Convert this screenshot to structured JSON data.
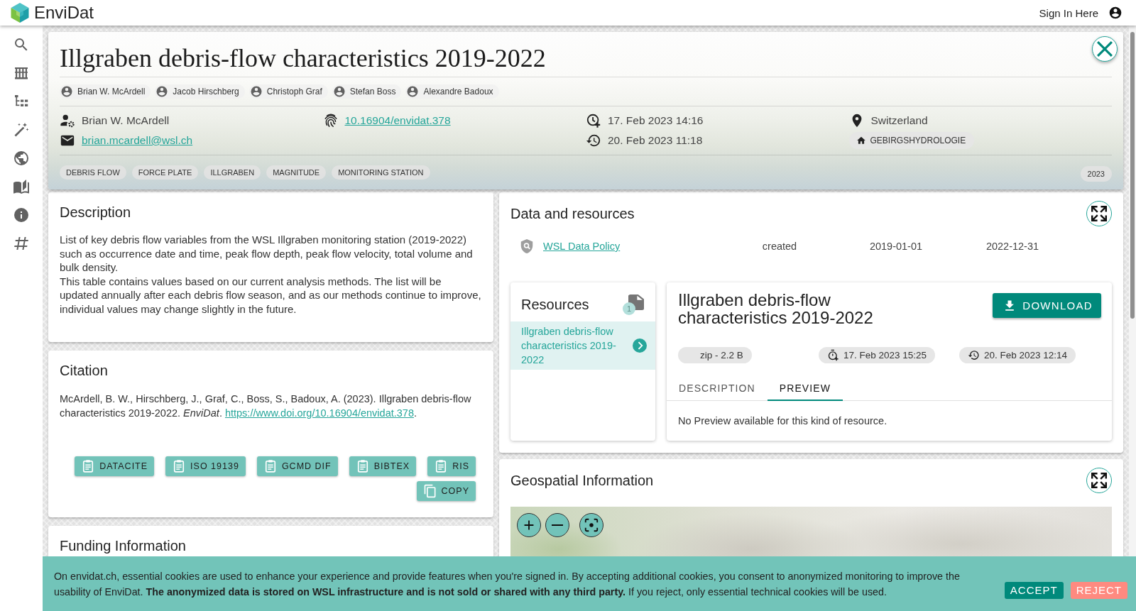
{
  "app_bar": {
    "brand": "EnviDat",
    "sign_in": "Sign In Here"
  },
  "sidebar": {
    "items": [
      {
        "kind": "search"
      },
      {
        "kind": "shelf"
      },
      {
        "kind": "tree"
      },
      {
        "kind": "tools"
      },
      {
        "kind": "globe"
      },
      {
        "kind": "guide"
      },
      {
        "kind": "info"
      },
      {
        "kind": "hash"
      }
    ]
  },
  "dataset_header": {
    "title": "Illgraben debris-flow characteristics 2019-2022",
    "authors": [
      "Brian W. McArdell",
      "Jacob Hirschberg",
      "Christoph Graf",
      "Stefan Boss",
      "Alexandre Badoux"
    ],
    "info_columns": [
      [
        {
          "kind": "contact",
          "text": "Brian W. McArdell"
        },
        {
          "kind": "email",
          "text": "brian.mcardell@wsl.ch"
        }
      ],
      [
        {
          "kind": "doi",
          "text": "10.16904/envidat.378"
        }
      ],
      [
        {
          "kind": "created",
          "text": "17. Feb 2023 14:16"
        },
        {
          "kind": "modified",
          "text": "20. Feb 2023 11:18"
        }
      ],
      [
        {
          "kind": "location",
          "text": "Switzerland"
        },
        {
          "kind": "organization",
          "text": "GEBIRGSHYDROLOGIE"
        }
      ]
    ],
    "tags": [
      "DEBRIS FLOW",
      "FORCE PLATE",
      "ILLGRABEN",
      "MAGNITUDE",
      "MONITORING STATION"
    ],
    "year": "2023"
  },
  "description": {
    "title": "Description",
    "paragraphs": [
      "List of key debris flow variables from the WSL Illgraben monitoring station (2019-2022) such as occurrence date and time, peak flow depth, peak flow velocity, total volume and bulk density.",
      "This table contains values based on our current analysis methods. The list will be updated annually after each debris flow season, and as our methods continue to improve, individual values may change slightly in the future."
    ]
  },
  "citation": {
    "title": "Citation",
    "text": "McArdell, B. W., Hirschberg, J., Graf, C., Boss, S., Badoux, A. (2023). Illgraben debris-flow characteristics 2019-2022. *EnviDat*.",
    "link": "https://www.doi.org/10.16904/envidat.378",
    "end": ".",
    "buttons": [
      {
        "kind": "export",
        "label": "DATACITE"
      },
      {
        "kind": "export",
        "label": "ISO 19139"
      },
      {
        "kind": "export",
        "label": "GCMD DIF"
      },
      {
        "kind": "export",
        "label": "BIBTEX"
      },
      {
        "kind": "export",
        "label": "RIS"
      },
      {
        "kind": "copy",
        "label": "COPY"
      }
    ]
  },
  "funding": {
    "title": "Funding Information"
  },
  "data_resources": {
    "title": "Data and resources",
    "license": "WSL Data Policy",
    "dates": [
      "created",
      "2019-01-01",
      "2022-12-31"
    ],
    "resources": {
      "title": "Resources",
      "count": "1",
      "items": [
        {
          "name": "Illgraben debris-flow characteristics 2019-2022",
          "selected": true
        }
      ]
    },
    "detail": {
      "title": "Illgraben debris-flow characteristics 2019-2022",
      "download": "DOWNLOAD",
      "chips": [
        {
          "kind": "format",
          "text": "zip - 2.2 B"
        },
        {
          "kind": "created",
          "text": "17. Feb 2023 15:25"
        },
        {
          "kind": "modified",
          "text": "20. Feb 2023 12:14"
        }
      ],
      "tabs": [
        {
          "label": "DESCRIPTION",
          "selected": false
        },
        {
          "label": "PREVIEW",
          "selected": true
        }
      ],
      "preview": "No Preview available for this kind of resource."
    }
  },
  "geospatial": {
    "title": "Geospatial Information",
    "map_controls": [
      {
        "kind": "zoom_in"
      },
      {
        "kind": "zoom_out"
      },
      {
        "kind": "fit"
      }
    ]
  },
  "cookie_banner": {
    "text": "On envidat.ch, essential cookies are used to enhance your experience and provide features when you're signed in. By accepting additional cookies, you consent to anonymized monitoring to improve the usability of EnviDat. **The anonymized data is stored on WSL infrastructure and is not sold or shared with any third party.** If you reject, only essential technical cookies will be used.",
    "accept": "ACCEPT",
    "reject": "REJECT"
  }
}
